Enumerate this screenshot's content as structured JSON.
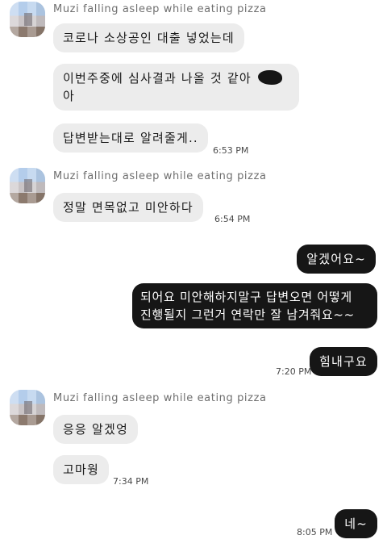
{
  "sender_name": "Muzi falling asleep while eating pizza",
  "messages": {
    "m1": "코로나 소상공인 대출 넣었는데",
    "m2_line1": "이번주중에 심사결과 나올 것 같아",
    "m2_line2": "아",
    "m3": "답변받는대로 알려줄게..",
    "m4": "정말 면목없고 미안하다",
    "m5": "알겠어요~",
    "m6_line1": "되어요 미안해하지말구 답변오면 어떻게",
    "m6_line2": "진행될지 그런거 연락만 잘 남겨줘요~~",
    "m7": "힘내구요",
    "m8": "응응 알겠엉",
    "m9": "고마웡",
    "m10": "네~"
  },
  "times": {
    "t1": "6:53 PM",
    "t2": "6:54 PM",
    "t3": "7:20 PM",
    "t4": "7:34 PM",
    "t5": "8:05 PM"
  },
  "icons": {
    "redaction": "redacted-emoji-blob"
  }
}
